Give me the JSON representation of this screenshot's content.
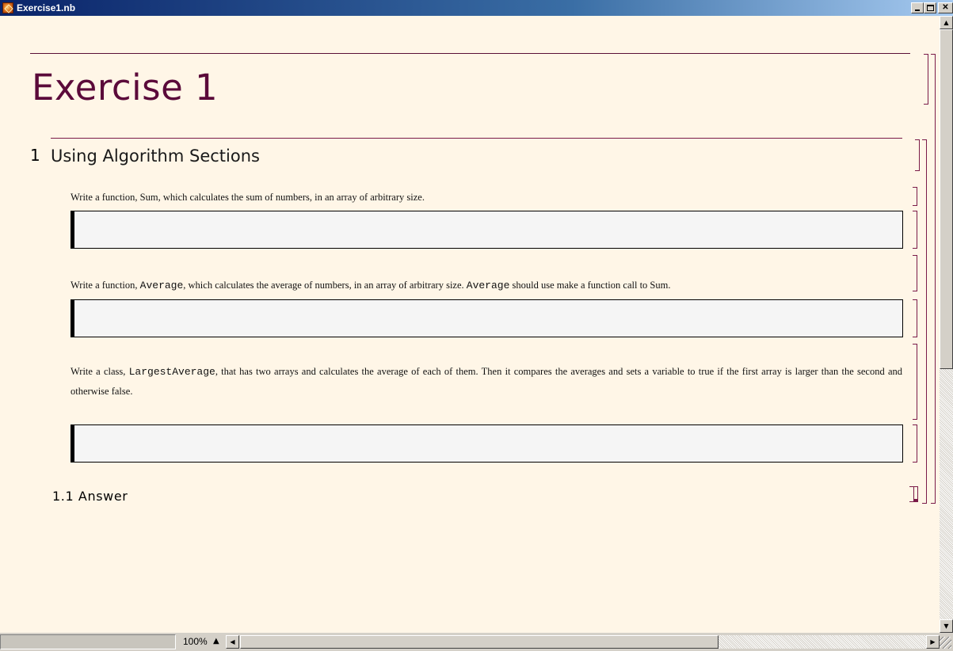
{
  "window": {
    "title": "Exercise1.nb"
  },
  "notebook": {
    "title": "Exercise 1",
    "section": {
      "number": "1",
      "title": "Using Algorithm Sections"
    },
    "cells": {
      "q1": {
        "pre": "Write a function, ",
        "code": "Sum",
        "post": ", which calculates the sum of numbers, in an array of arbitrary size."
      },
      "q2": {
        "pre": "Write a function, ",
        "code1": "Average",
        "mid": ", which calculates the average of numbers, in an array of arbitrary size. ",
        "code2": "Average",
        "mid2": " should use make a function call to ",
        "code3": "Sum",
        "post": "."
      },
      "q3": {
        "pre": "Write a class, ",
        "code": "LargestAverage",
        "post": ", that has two arrays and calculates the average of each of them. Then it compares the averages and sets a variable to true if the first array is larger than the second and otherwise false."
      },
      "inputs": [
        "",
        "",
        ""
      ]
    },
    "subsection": {
      "title": "1.1 Answer"
    }
  },
  "status": {
    "zoom": "100%"
  }
}
